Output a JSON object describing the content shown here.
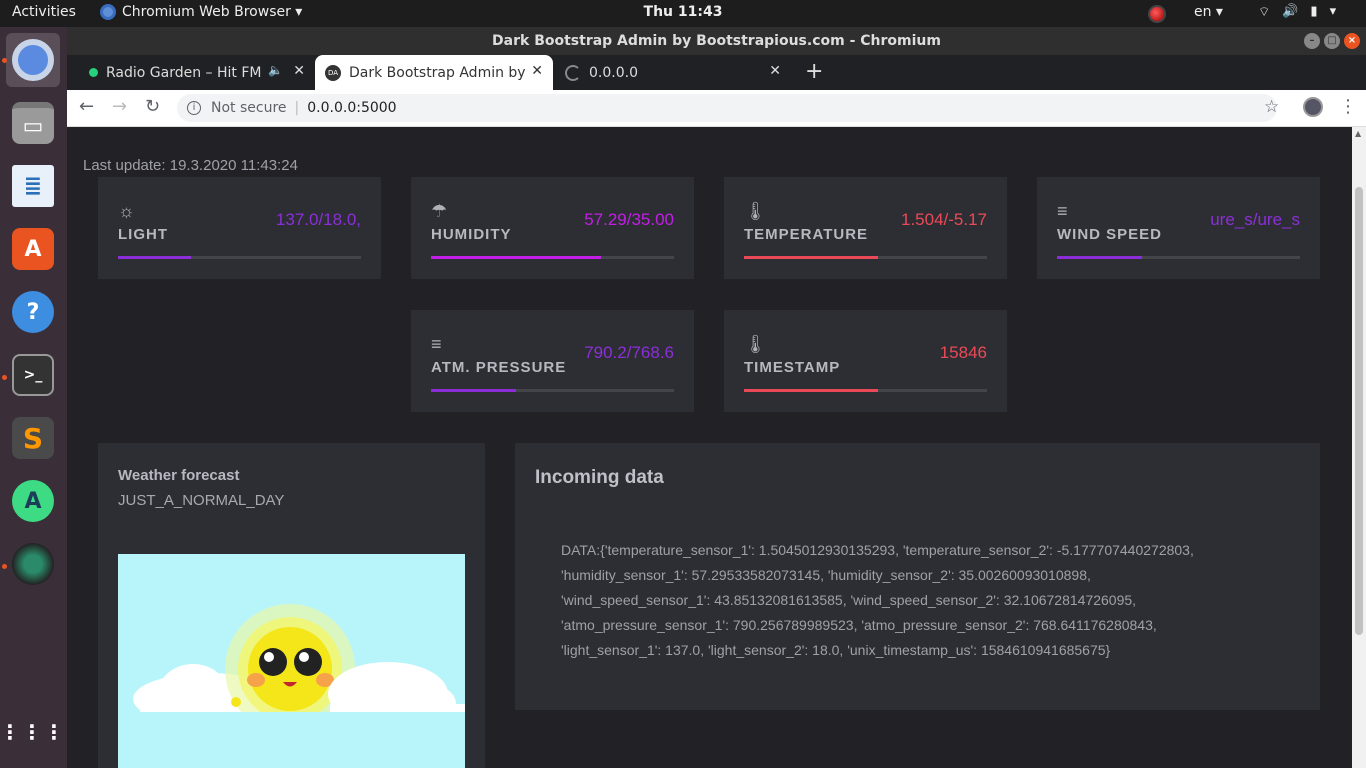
{
  "topbar": {
    "activities": "Activities",
    "app_menu": "Chromium Web Browser ▾",
    "clock": "Thu 11:43",
    "lang": "en ▾"
  },
  "window": {
    "title": "Dark Bootstrap Admin by Bootstrapious.com - Chromium"
  },
  "tabs": [
    {
      "title": "Radio Garden – Hit FM",
      "favicon_color": "#26d07c"
    },
    {
      "title": "Dark Bootstrap Admin by",
      "favicon_text": "DA"
    },
    {
      "title": "0.0.0.0"
    }
  ],
  "omnibox": {
    "security": "Not secure",
    "url": "0.0.0.0:5000"
  },
  "page": {
    "last_update": "Last update: 19.3.2020 11:43:24",
    "cards": [
      {
        "name": "LIGHT",
        "value": "137.0/18.0,",
        "icon": "sun-icon",
        "glyph": "☼",
        "color": "#8b2ed8",
        "progress": 0.3
      },
      {
        "name": "HUMIDITY",
        "value": "57.29/35.00",
        "icon": "umbrella-icon",
        "glyph": "☂",
        "color": "#c21ee6",
        "progress": 0.7
      },
      {
        "name": "TEMPERATURE",
        "value": "1.504/-5.17",
        "icon": "thermometer-icon",
        "glyph": "🌡",
        "color": "#ea4a58",
        "progress": 0.55
      },
      {
        "name": "WIND SPEED",
        "value": "ure_s/ure_s",
        "icon": "bars-icon",
        "glyph": "≡",
        "color": "#8b2ed8",
        "progress": 0.35
      },
      {
        "name": "ATM. PRESSURE",
        "value": "790.2/768.6",
        "icon": "bars-icon",
        "glyph": "≡",
        "color": "#8b2ed8",
        "progress": 0.35
      },
      {
        "name": "TIMESTAMP",
        "value": "15846",
        "icon": "thermometer-icon",
        "glyph": "🌡",
        "color": "#ea4a58",
        "progress": 0.55
      }
    ],
    "forecast": {
      "title": "Weather forecast",
      "value": "JUST_A_NORMAL_DAY"
    },
    "incoming": {
      "title": "Incoming data",
      "lines": [
        "DATA:{'temperature_sensor_1': 1.5045012930135293, 'temperature_sensor_2': -5.177707440272803,",
        "'humidity_sensor_1': 57.29533582073145, 'humidity_sensor_2': 35.00260093010898,",
        "'wind_speed_sensor_1': 43.85132081613585, 'wind_speed_sensor_2': 32.10672814726095,",
        "'atmo_pressure_sensor_1': 790.256789989523, 'atmo_pressure_sensor_2': 768.641176280843,",
        "'light_sensor_1': 137.0, 'light_sensor_2': 18.0, 'unix_timestamp_us': 1584610941685675}"
      ]
    }
  }
}
